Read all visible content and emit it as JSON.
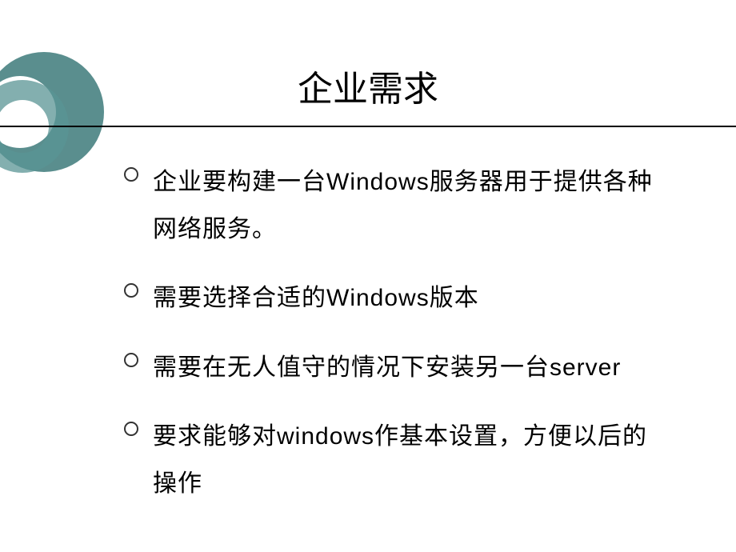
{
  "slide": {
    "title": "企业需求",
    "bullets": [
      "企业要构建一台Windows服务器用于提供各种网络服务。",
      "需要选择合适的Windows版本",
      "需要在无人值守的情况下安装另一台server",
      "要求能够对windows作基本设置，方便以后的操作"
    ]
  },
  "decoration": {
    "color": "#3d7a7a"
  }
}
